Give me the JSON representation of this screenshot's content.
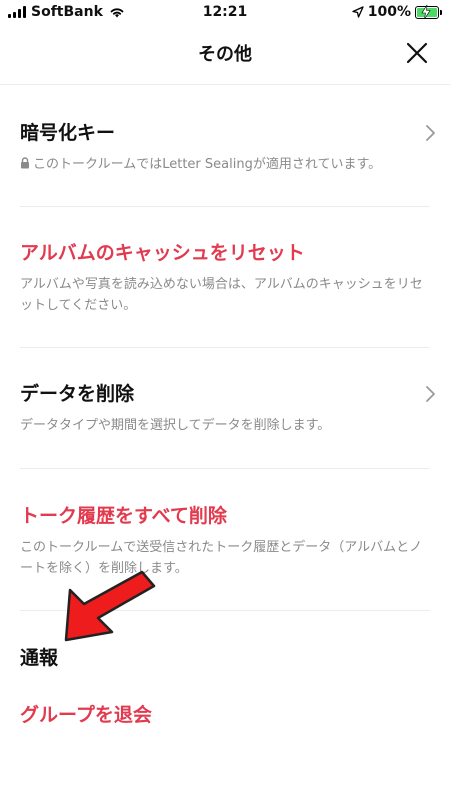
{
  "status_bar": {
    "carrier": "SoftBank",
    "time": "12:21",
    "battery_percent": "100%"
  },
  "header": {
    "title": "その他"
  },
  "items": [
    {
      "title": "暗号化キー",
      "description": "このトークルームではLetter Sealingが適用されています。"
    },
    {
      "title": "アルバムのキャッシュをリセット",
      "description": "アルバムや写真を読み込めない場合は、アルバムのキャッシュをリセットしてください。"
    },
    {
      "title": "データを削除",
      "description": "データタイプや期間を選択してデータを削除します。"
    },
    {
      "title": "トーク履歴をすべて削除",
      "description": "このトークルームで送受信されたトーク履歴とデータ（アルバムとノートを除く）を削除します。"
    },
    {
      "title": "通報"
    },
    {
      "title": "グループを退会"
    }
  ],
  "colors": {
    "accent_red": "#e23a4e",
    "description_gray": "#8a8a8a",
    "annotation_arrow": "#ee1c1c"
  },
  "icons": [
    "signal-icon",
    "wifi-icon",
    "location-icon",
    "battery-icon",
    "close-icon",
    "lock-icon",
    "chevron-right-icon"
  ]
}
